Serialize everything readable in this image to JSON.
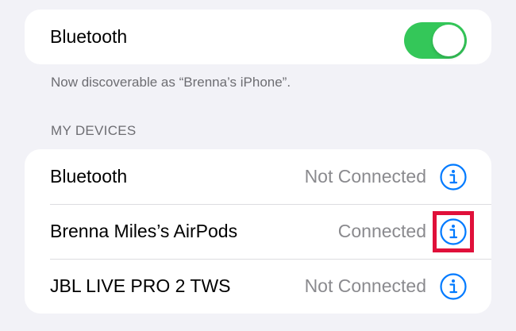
{
  "bluetooth_toggle": {
    "label": "Bluetooth",
    "state": "on",
    "on_color": "#34c759"
  },
  "discoverable_note": "Now discoverable as “Brenna’s iPhone”.",
  "my_devices": {
    "header": "MY DEVICES",
    "items": [
      {
        "name": "Bluetooth",
        "status": "Not Connected",
        "icon": "info-icon"
      },
      {
        "name": "Brenna Miles’s AirPods",
        "status": "Connected",
        "icon": "info-icon",
        "highlighted": true
      },
      {
        "name": "JBL LIVE PRO 2 TWS",
        "status": "Not Connected",
        "icon": "info-icon"
      }
    ]
  },
  "colors": {
    "background": "#f2f2f7",
    "card": "#ffffff",
    "accent_blue": "#007aff",
    "secondary_text": "#8a8a8e",
    "highlight_box": "#e0103a"
  }
}
